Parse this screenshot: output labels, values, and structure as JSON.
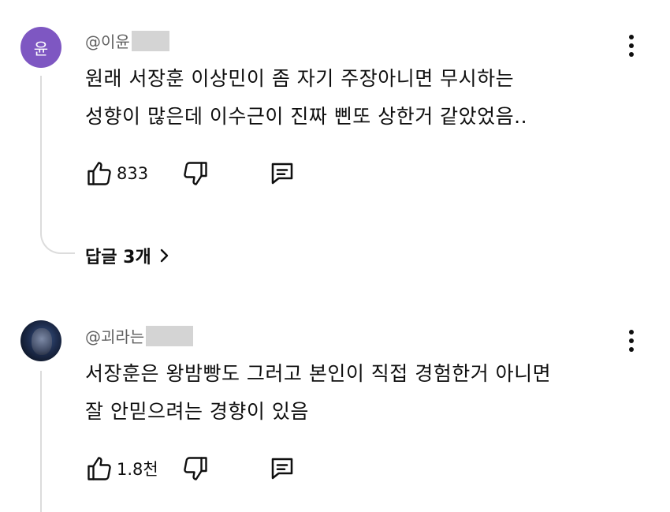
{
  "comments": [
    {
      "avatar_letter": "윤",
      "avatar_color": "#7e57c2",
      "author": "@이윤",
      "text_lines": [
        "원래 서장훈 이상민이 좀 자기 주장아니면 무시하는",
        "성향이 많은데 이수근이 진짜 삔또 상한거 같았었음.."
      ],
      "likes": "833",
      "replies_label": "답글 3개"
    },
    {
      "author": "@괴라는",
      "text_lines": [
        "서장훈은 왕밤빵도 그러고 본인이 직접 경험한거 아니면",
        "잘 안믿으려는 경향이 있음"
      ],
      "likes": "1.8천"
    }
  ],
  "icons": {
    "like": "thumbs-up-icon",
    "dislike": "thumbs-down-icon",
    "reply": "comment-icon",
    "more": "more-vertical-icon",
    "chevron": "chevron-right-icon"
  }
}
